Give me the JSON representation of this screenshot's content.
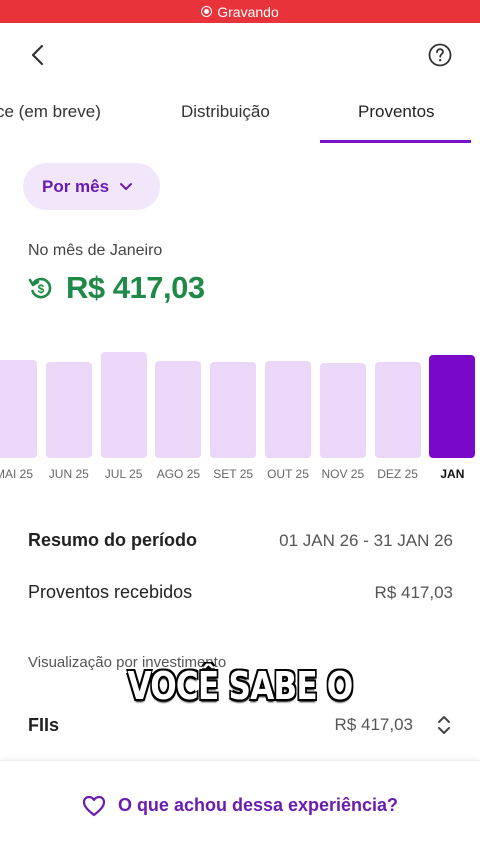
{
  "recording": {
    "label": "Gravando"
  },
  "tabs": [
    {
      "label": "ce (em breve)"
    },
    {
      "label": "Distribuição"
    },
    {
      "label": "Proventos"
    }
  ],
  "period_select": {
    "label": "Por mês"
  },
  "summary": {
    "month_caption": "No mês de Janeiro",
    "total": "R$ 417,03"
  },
  "chart_data": {
    "type": "bar",
    "categories": [
      "MAI 25",
      "JUN 25",
      "JUL 25",
      "AGO 25",
      "SET 25",
      "OUT 25",
      "NOV 25",
      "DEZ 25",
      "JAN"
    ],
    "values": [
      98,
      96,
      106,
      97,
      96,
      97,
      95,
      96,
      103
    ],
    "selected": "JAN",
    "xlabel": "",
    "ylabel": "",
    "colors": {
      "bar": "#ebd8f8",
      "selected": "#7a08c9"
    }
  },
  "period": {
    "title": "Resumo do período",
    "range": "01 JAN 26 - 31 JAN 26"
  },
  "received": {
    "title": "Proventos recebidos",
    "value": "R$ 417,03"
  },
  "by_investment": {
    "caption": "Visualização por investimento"
  },
  "video_caption": "VOCÊ SABE O",
  "fii": {
    "title": "FIIs",
    "value": "R$ 417,03"
  },
  "footer": {
    "label": "O que achou dessa experiência?"
  },
  "colors": {
    "accent": "#7a12c8",
    "positive": "#1f8a47",
    "recording": "#e8333b"
  }
}
